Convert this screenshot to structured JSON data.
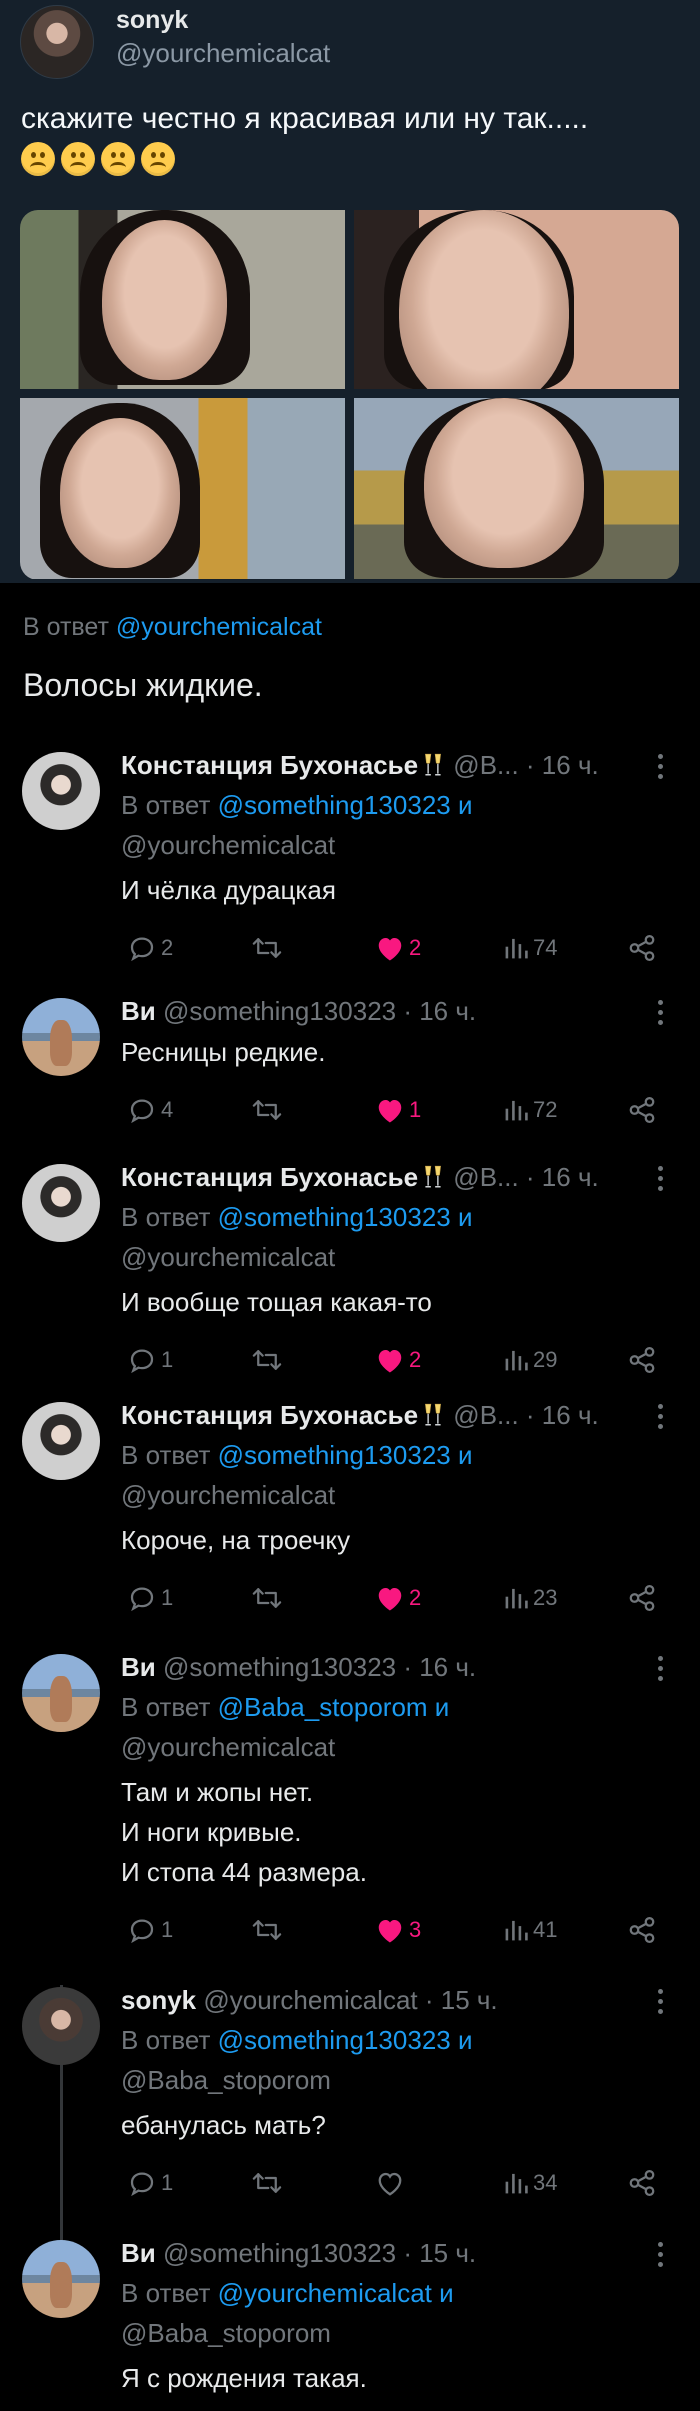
{
  "quote": {
    "name": "sonyk",
    "handle": "@yourchemicalcat",
    "text": "скажите честно я красивая или ну так.....",
    "emoji_count": 4,
    "emoji": "frowning-face"
  },
  "main_reply": {
    "reply_prefix": "В ответ ",
    "reply_to": "@yourchemicalcat",
    "text": "Волосы жидкие."
  },
  "colors": {
    "like": "#f91880",
    "link": "#1d9bf0",
    "muted": "#71767b"
  },
  "replies": [
    {
      "author": "Констанция Бухонасье",
      "has_champagne": true,
      "meta": "@В... · 16 ч.",
      "reply_line1": "В ответ @something130323 и",
      "reply_line2": "@yourchemicalcat",
      "text_lines": [
        "И чёлка дурацкая"
      ],
      "comments": "2",
      "liked": true,
      "likes": "2",
      "views": "74",
      "avatar": "konst"
    },
    {
      "author": "Ви",
      "has_champagne": false,
      "meta": "@something130323 · 16 ч.",
      "reply_line1": "",
      "reply_line2": "",
      "text_lines": [
        "Ресницы редкие."
      ],
      "comments": "4",
      "liked": true,
      "likes": "1",
      "views": "72",
      "avatar": "vi"
    },
    {
      "author": "Констанция Бухонасье",
      "has_champagne": true,
      "meta": "@В... · 16 ч.",
      "reply_line1": "В ответ @something130323 и",
      "reply_line2": "@yourchemicalcat",
      "text_lines": [
        "И вообще тощая какая-то"
      ],
      "comments": "1",
      "liked": true,
      "likes": "2",
      "views": "29",
      "avatar": "konst"
    },
    {
      "author": "Констанция Бухонасье",
      "has_champagne": true,
      "meta": "@В... · 16 ч.",
      "reply_line1": "В ответ @something130323 и",
      "reply_line2": "@yourchemicalcat",
      "text_lines": [
        "Короче, на троечку"
      ],
      "comments": "1",
      "liked": true,
      "likes": "2",
      "views": "23",
      "avatar": "konst"
    },
    {
      "author": "Ви",
      "has_champagne": false,
      "meta": "@something130323 · 16 ч.",
      "reply_line1": "В ответ @Baba_stoporom и",
      "reply_line2": "@yourchemicalcat",
      "text_lines": [
        "Там и жопы нет.",
        "И ноги кривые.",
        "И стопа 44 размера."
      ],
      "comments": "1",
      "liked": true,
      "likes": "3",
      "views": "41",
      "avatar": "vi"
    },
    {
      "author": "sonyk",
      "has_champagne": false,
      "meta": "@yourchemicalcat · 15 ч.",
      "reply_line1": "В ответ @something130323 и",
      "reply_line2": "@Baba_stoporom",
      "text_lines": [
        "ебанулась мать?"
      ],
      "comments": "1",
      "liked": false,
      "likes": "",
      "views": "34",
      "avatar": "sonyk"
    },
    {
      "author": "Ви",
      "has_champagne": false,
      "meta": "@something130323 · 15 ч.",
      "reply_line1": "В ответ @yourchemicalcat и",
      "reply_line2": "@Baba_stoporom",
      "text_lines": [
        "Я с рождения такая."
      ],
      "comments": "",
      "liked": false,
      "likes": "",
      "views": "",
      "avatar": "vi",
      "hide_actions": true
    }
  ]
}
